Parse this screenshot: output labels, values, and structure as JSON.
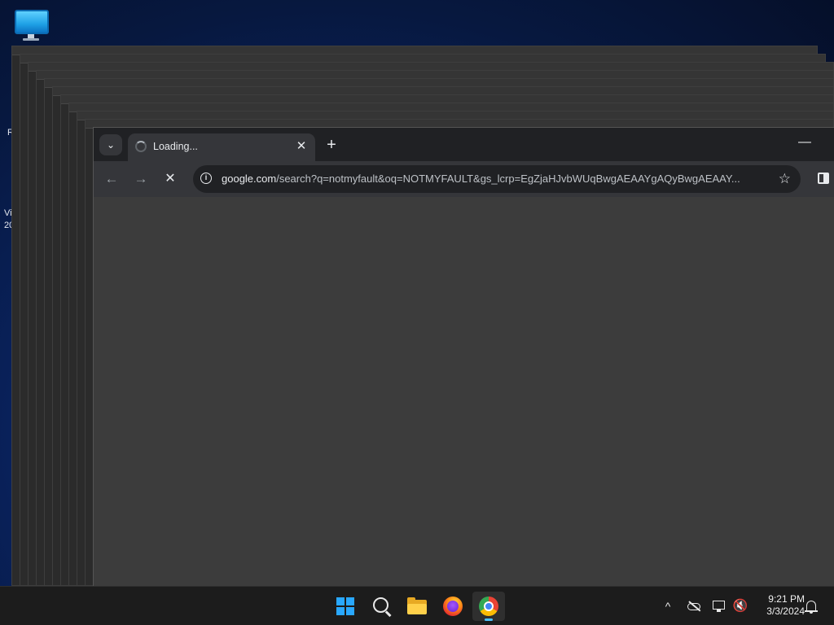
{
  "desktop": {
    "icons": [
      {
        "name": "This PC",
        "icon": "monitor-icon"
      }
    ],
    "label_fragments": [
      "R",
      "Vi",
      "20"
    ]
  },
  "browser": {
    "tab_search_icon": "chevron-down-icon",
    "tab": {
      "title": "Loading...",
      "favicon": "loading-spinner-icon",
      "close_glyph": "✕"
    },
    "new_tab_glyph": "+",
    "window_minimize_glyph": "—",
    "toolbar": {
      "back_glyph": "←",
      "forward_glyph": "→",
      "stop_glyph": "✕",
      "address": {
        "domain": "google.com",
        "path": "/search?q=notmyfault&oq=NOTMYFAULT&gs_lcrp=EgZjaHJvbWUqBwgAEAAYgAQyBwgAEAAY...",
        "info_icon": "info-icon"
      },
      "bookmark_glyph": "☆",
      "side_panel_icon": "side-panel-icon"
    }
  },
  "taskbar": {
    "apps": [
      {
        "name": "Start",
        "icon": "windows-logo-icon"
      },
      {
        "name": "Search",
        "icon": "search-icon"
      },
      {
        "name": "File Explorer",
        "icon": "folder-icon"
      },
      {
        "name": "Firefox",
        "icon": "firefox-icon"
      },
      {
        "name": "Google Chrome",
        "icon": "chrome-icon",
        "active": true
      }
    ],
    "tray": {
      "overflow_glyph": "^",
      "volume_glyph": "🔇",
      "time": "9:21 PM",
      "date": "3/3/2024"
    }
  },
  "colors": {
    "accent": "#4cc2ff",
    "windows_blue": "#29a8ff",
    "browser_dark": "#202124",
    "toolbar": "#35363a"
  }
}
